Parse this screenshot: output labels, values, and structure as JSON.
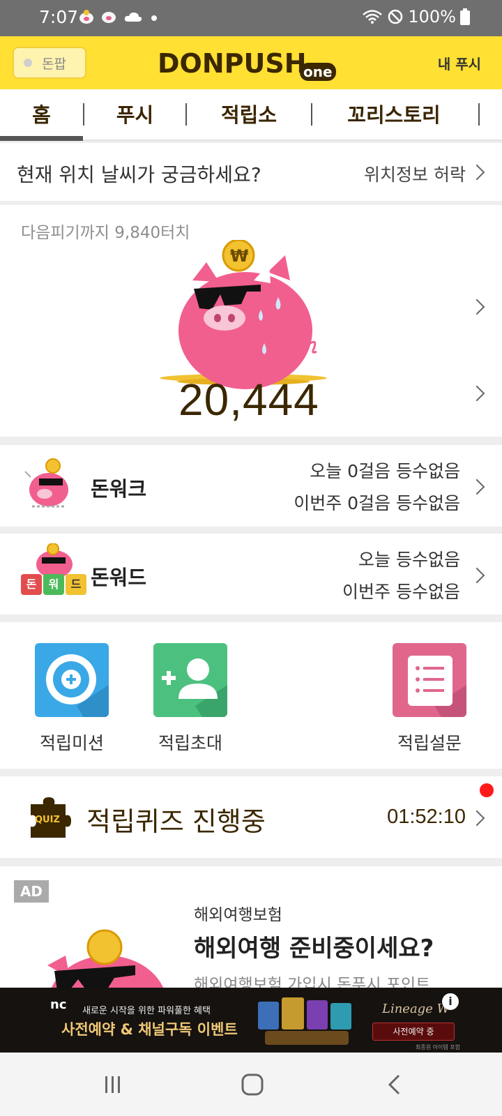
{
  "status_bar": {
    "time": "7:07",
    "battery": "100%"
  },
  "header": {
    "donpan_label": "돈팝",
    "logo_text": "DONPUSH",
    "logo_suffix": "one",
    "my_push": "내 푸시"
  },
  "tabs": [
    {
      "label": "홈",
      "active": true
    },
    {
      "label": "푸시"
    },
    {
      "label": "적립소"
    },
    {
      "label": "꼬리스토리"
    }
  ],
  "weather": {
    "question": "현재 위치 날씨가 궁금하세요?",
    "permission": "위치정보 허락"
  },
  "piggy": {
    "next_text": "다음피기까지 9,840터치",
    "count": "20,444",
    "coin_symbol": "₩"
  },
  "donwalk": {
    "title": "돈워크",
    "today": "오늘 0걸음 등수없음",
    "this_week": "이번주 0걸음 등수없음"
  },
  "donword": {
    "title": "돈워드",
    "today": "오늘 등수없음",
    "this_week": "이번주 등수없음",
    "tiles": [
      "돈",
      "워",
      "드"
    ]
  },
  "quick_actions": [
    {
      "label": "적립미션",
      "color": "#3aa8e6"
    },
    {
      "label": "적립초대",
      "color": "#4cc17f"
    },
    {
      "label": "적립설문",
      "color": "#e0678b"
    }
  ],
  "quiz": {
    "icon_text": "QUIZ",
    "title": "적립퀴즈 진행중",
    "timer": "01:52:10"
  },
  "ad": {
    "badge": "AD",
    "category": "해외여행보험",
    "headline": "해외여행 준비중이세요?",
    "subtext": "해외여행보험 가입시 돈푸시 포인트"
  },
  "banner": {
    "brand": "nc",
    "line1": "새로운 시작을 위한 파워풀한 혜택",
    "line2": "사전예약 & 채널구독 이벤트",
    "game": "Lineage W",
    "button": "사전예약 중",
    "info": "i",
    "fine_print": "최종원 아이템 포함"
  }
}
